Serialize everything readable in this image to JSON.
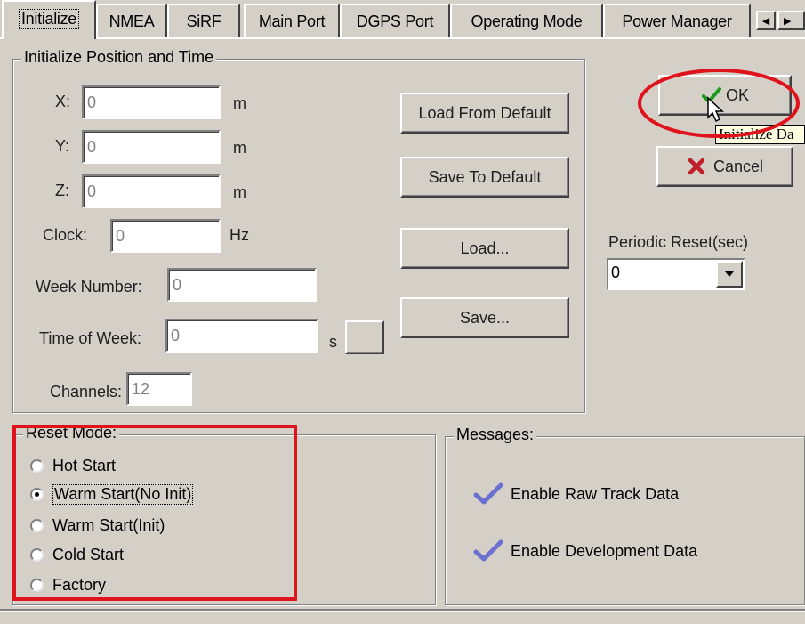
{
  "tabs": [
    "Initialize",
    "NMEA",
    "SiRF",
    "Main Port",
    "DGPS Port",
    "Operating Mode",
    "Power Manager"
  ],
  "init_group": {
    "title": "Initialize Position and Time",
    "x_label": "X:",
    "x_value": "0",
    "x_unit": "m",
    "y_label": "Y:",
    "y_value": "0",
    "y_unit": "m",
    "z_label": "Z:",
    "z_value": "0",
    "z_unit": "m",
    "clock_label": "Clock:",
    "clock_value": "0",
    "clock_unit": "Hz",
    "week_label": "Week Number:",
    "week_value": "0",
    "tow_label": "Time of Week:",
    "tow_value": "0",
    "tow_unit": "s",
    "channels_label": "Channels:",
    "channels_value": "12",
    "buttons": {
      "load_default": "Load From Default",
      "save_default": "Save To Default",
      "load": "Load...",
      "save": "Save..."
    }
  },
  "dialog_buttons": {
    "ok": "OK",
    "cancel": "Cancel"
  },
  "tooltip": "Initialize Da",
  "periodic": {
    "label": "Periodic Reset(sec)",
    "value": "0"
  },
  "reset_mode": {
    "title": "Reset Mode:",
    "options": [
      "Hot Start",
      "Warm Start(No Init)",
      "Warm Start(Init)",
      "Cold Start",
      "Factory"
    ],
    "selected": "Warm Start(No Init)"
  },
  "messages": {
    "title": "Messages:",
    "items": [
      {
        "label": "Enable Raw Track Data",
        "checked": true
      },
      {
        "label": "Enable Development Data",
        "checked": true
      }
    ]
  },
  "colors": {
    "face": "#d4d0c8",
    "highlight_annotation": "#e0121b"
  }
}
